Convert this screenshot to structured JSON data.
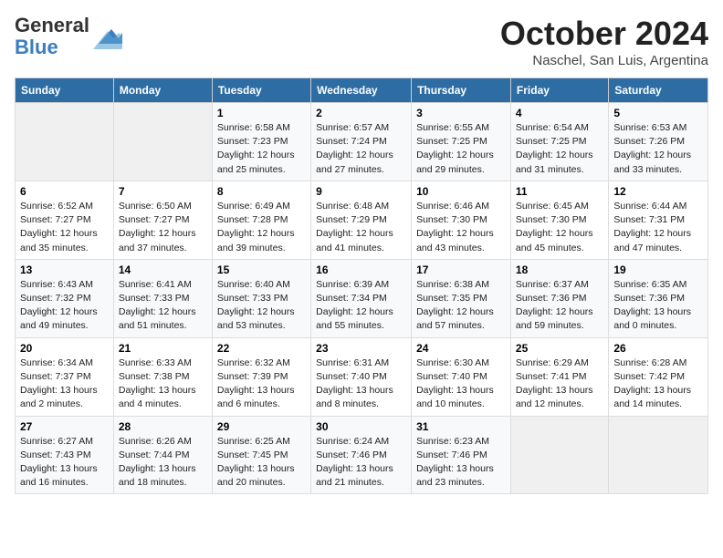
{
  "header": {
    "logo_general": "General",
    "logo_blue": "Blue",
    "month": "October 2024",
    "location": "Naschel, San Luis, Argentina"
  },
  "weekdays": [
    "Sunday",
    "Monday",
    "Tuesday",
    "Wednesday",
    "Thursday",
    "Friday",
    "Saturday"
  ],
  "weeks": [
    [
      {
        "day": "",
        "empty": true
      },
      {
        "day": "",
        "empty": true
      },
      {
        "day": "1",
        "sunrise": "6:58 AM",
        "sunset": "7:23 PM",
        "daylight": "12 hours and 25 minutes."
      },
      {
        "day": "2",
        "sunrise": "6:57 AM",
        "sunset": "7:24 PM",
        "daylight": "12 hours and 27 minutes."
      },
      {
        "day": "3",
        "sunrise": "6:55 AM",
        "sunset": "7:25 PM",
        "daylight": "12 hours and 29 minutes."
      },
      {
        "day": "4",
        "sunrise": "6:54 AM",
        "sunset": "7:25 PM",
        "daylight": "12 hours and 31 minutes."
      },
      {
        "day": "5",
        "sunrise": "6:53 AM",
        "sunset": "7:26 PM",
        "daylight": "12 hours and 33 minutes."
      }
    ],
    [
      {
        "day": "6",
        "sunrise": "6:52 AM",
        "sunset": "7:27 PM",
        "daylight": "12 hours and 35 minutes."
      },
      {
        "day": "7",
        "sunrise": "6:50 AM",
        "sunset": "7:27 PM",
        "daylight": "12 hours and 37 minutes."
      },
      {
        "day": "8",
        "sunrise": "6:49 AM",
        "sunset": "7:28 PM",
        "daylight": "12 hours and 39 minutes."
      },
      {
        "day": "9",
        "sunrise": "6:48 AM",
        "sunset": "7:29 PM",
        "daylight": "12 hours and 41 minutes."
      },
      {
        "day": "10",
        "sunrise": "6:46 AM",
        "sunset": "7:30 PM",
        "daylight": "12 hours and 43 minutes."
      },
      {
        "day": "11",
        "sunrise": "6:45 AM",
        "sunset": "7:30 PM",
        "daylight": "12 hours and 45 minutes."
      },
      {
        "day": "12",
        "sunrise": "6:44 AM",
        "sunset": "7:31 PM",
        "daylight": "12 hours and 47 minutes."
      }
    ],
    [
      {
        "day": "13",
        "sunrise": "6:43 AM",
        "sunset": "7:32 PM",
        "daylight": "12 hours and 49 minutes."
      },
      {
        "day": "14",
        "sunrise": "6:41 AM",
        "sunset": "7:33 PM",
        "daylight": "12 hours and 51 minutes."
      },
      {
        "day": "15",
        "sunrise": "6:40 AM",
        "sunset": "7:33 PM",
        "daylight": "12 hours and 53 minutes."
      },
      {
        "day": "16",
        "sunrise": "6:39 AM",
        "sunset": "7:34 PM",
        "daylight": "12 hours and 55 minutes."
      },
      {
        "day": "17",
        "sunrise": "6:38 AM",
        "sunset": "7:35 PM",
        "daylight": "12 hours and 57 minutes."
      },
      {
        "day": "18",
        "sunrise": "6:37 AM",
        "sunset": "7:36 PM",
        "daylight": "12 hours and 59 minutes."
      },
      {
        "day": "19",
        "sunrise": "6:35 AM",
        "sunset": "7:36 PM",
        "daylight": "13 hours and 0 minutes."
      }
    ],
    [
      {
        "day": "20",
        "sunrise": "6:34 AM",
        "sunset": "7:37 PM",
        "daylight": "13 hours and 2 minutes."
      },
      {
        "day": "21",
        "sunrise": "6:33 AM",
        "sunset": "7:38 PM",
        "daylight": "13 hours and 4 minutes."
      },
      {
        "day": "22",
        "sunrise": "6:32 AM",
        "sunset": "7:39 PM",
        "daylight": "13 hours and 6 minutes."
      },
      {
        "day": "23",
        "sunrise": "6:31 AM",
        "sunset": "7:40 PM",
        "daylight": "13 hours and 8 minutes."
      },
      {
        "day": "24",
        "sunrise": "6:30 AM",
        "sunset": "7:40 PM",
        "daylight": "13 hours and 10 minutes."
      },
      {
        "day": "25",
        "sunrise": "6:29 AM",
        "sunset": "7:41 PM",
        "daylight": "13 hours and 12 minutes."
      },
      {
        "day": "26",
        "sunrise": "6:28 AM",
        "sunset": "7:42 PM",
        "daylight": "13 hours and 14 minutes."
      }
    ],
    [
      {
        "day": "27",
        "sunrise": "6:27 AM",
        "sunset": "7:43 PM",
        "daylight": "13 hours and 16 minutes."
      },
      {
        "day": "28",
        "sunrise": "6:26 AM",
        "sunset": "7:44 PM",
        "daylight": "13 hours and 18 minutes."
      },
      {
        "day": "29",
        "sunrise": "6:25 AM",
        "sunset": "7:45 PM",
        "daylight": "13 hours and 20 minutes."
      },
      {
        "day": "30",
        "sunrise": "6:24 AM",
        "sunset": "7:46 PM",
        "daylight": "13 hours and 21 minutes."
      },
      {
        "day": "31",
        "sunrise": "6:23 AM",
        "sunset": "7:46 PM",
        "daylight": "13 hours and 23 minutes."
      },
      {
        "day": "",
        "empty": true
      },
      {
        "day": "",
        "empty": true
      }
    ]
  ]
}
